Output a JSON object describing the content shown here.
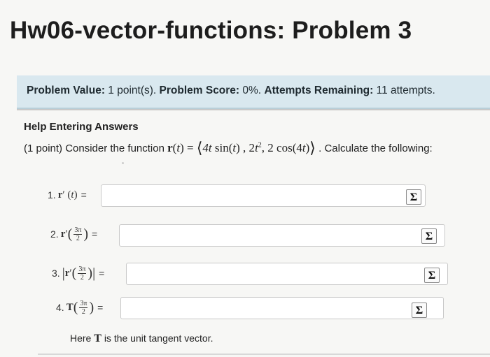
{
  "page": {
    "title": "Hw06-vector-functions: Problem 3"
  },
  "score": {
    "value_label": "Problem Value:",
    "value_text": "1 point(s).",
    "score_label": "Problem Score:",
    "score_text": "0%.",
    "attempts_label": "Attempts Remaining:",
    "attempts_text": "11 attempts."
  },
  "help": {
    "label": "Help Entering Answers"
  },
  "problem": {
    "intro": "(1 point) Consider the function",
    "function_lhs": "r(t) =",
    "function_rhs": "4t sin(t) , 2t², 2 cos(4t)",
    "outro": ". Calculate the following:"
  },
  "questions": [
    {
      "number": "1.",
      "expr": "r′(t)",
      "eq": "=",
      "answer": ""
    },
    {
      "number": "2.",
      "expr": "r′",
      "frac_num": "3π",
      "frac_den": "2",
      "eq": "=",
      "answer": ""
    },
    {
      "number": "3.",
      "expr": "r′",
      "frac_num": "3π",
      "frac_den": "2",
      "eq": "=",
      "answer": ""
    },
    {
      "number": "4.",
      "expr": "T",
      "frac_num": "3π",
      "frac_den": "2",
      "eq": "=",
      "answer": ""
    }
  ],
  "equation_editor": {
    "icon": "sigma-icon",
    "glyph": "Σ"
  },
  "footer": {
    "pre": "Here",
    "symbol": "T",
    "post": "is the unit tangent vector."
  }
}
